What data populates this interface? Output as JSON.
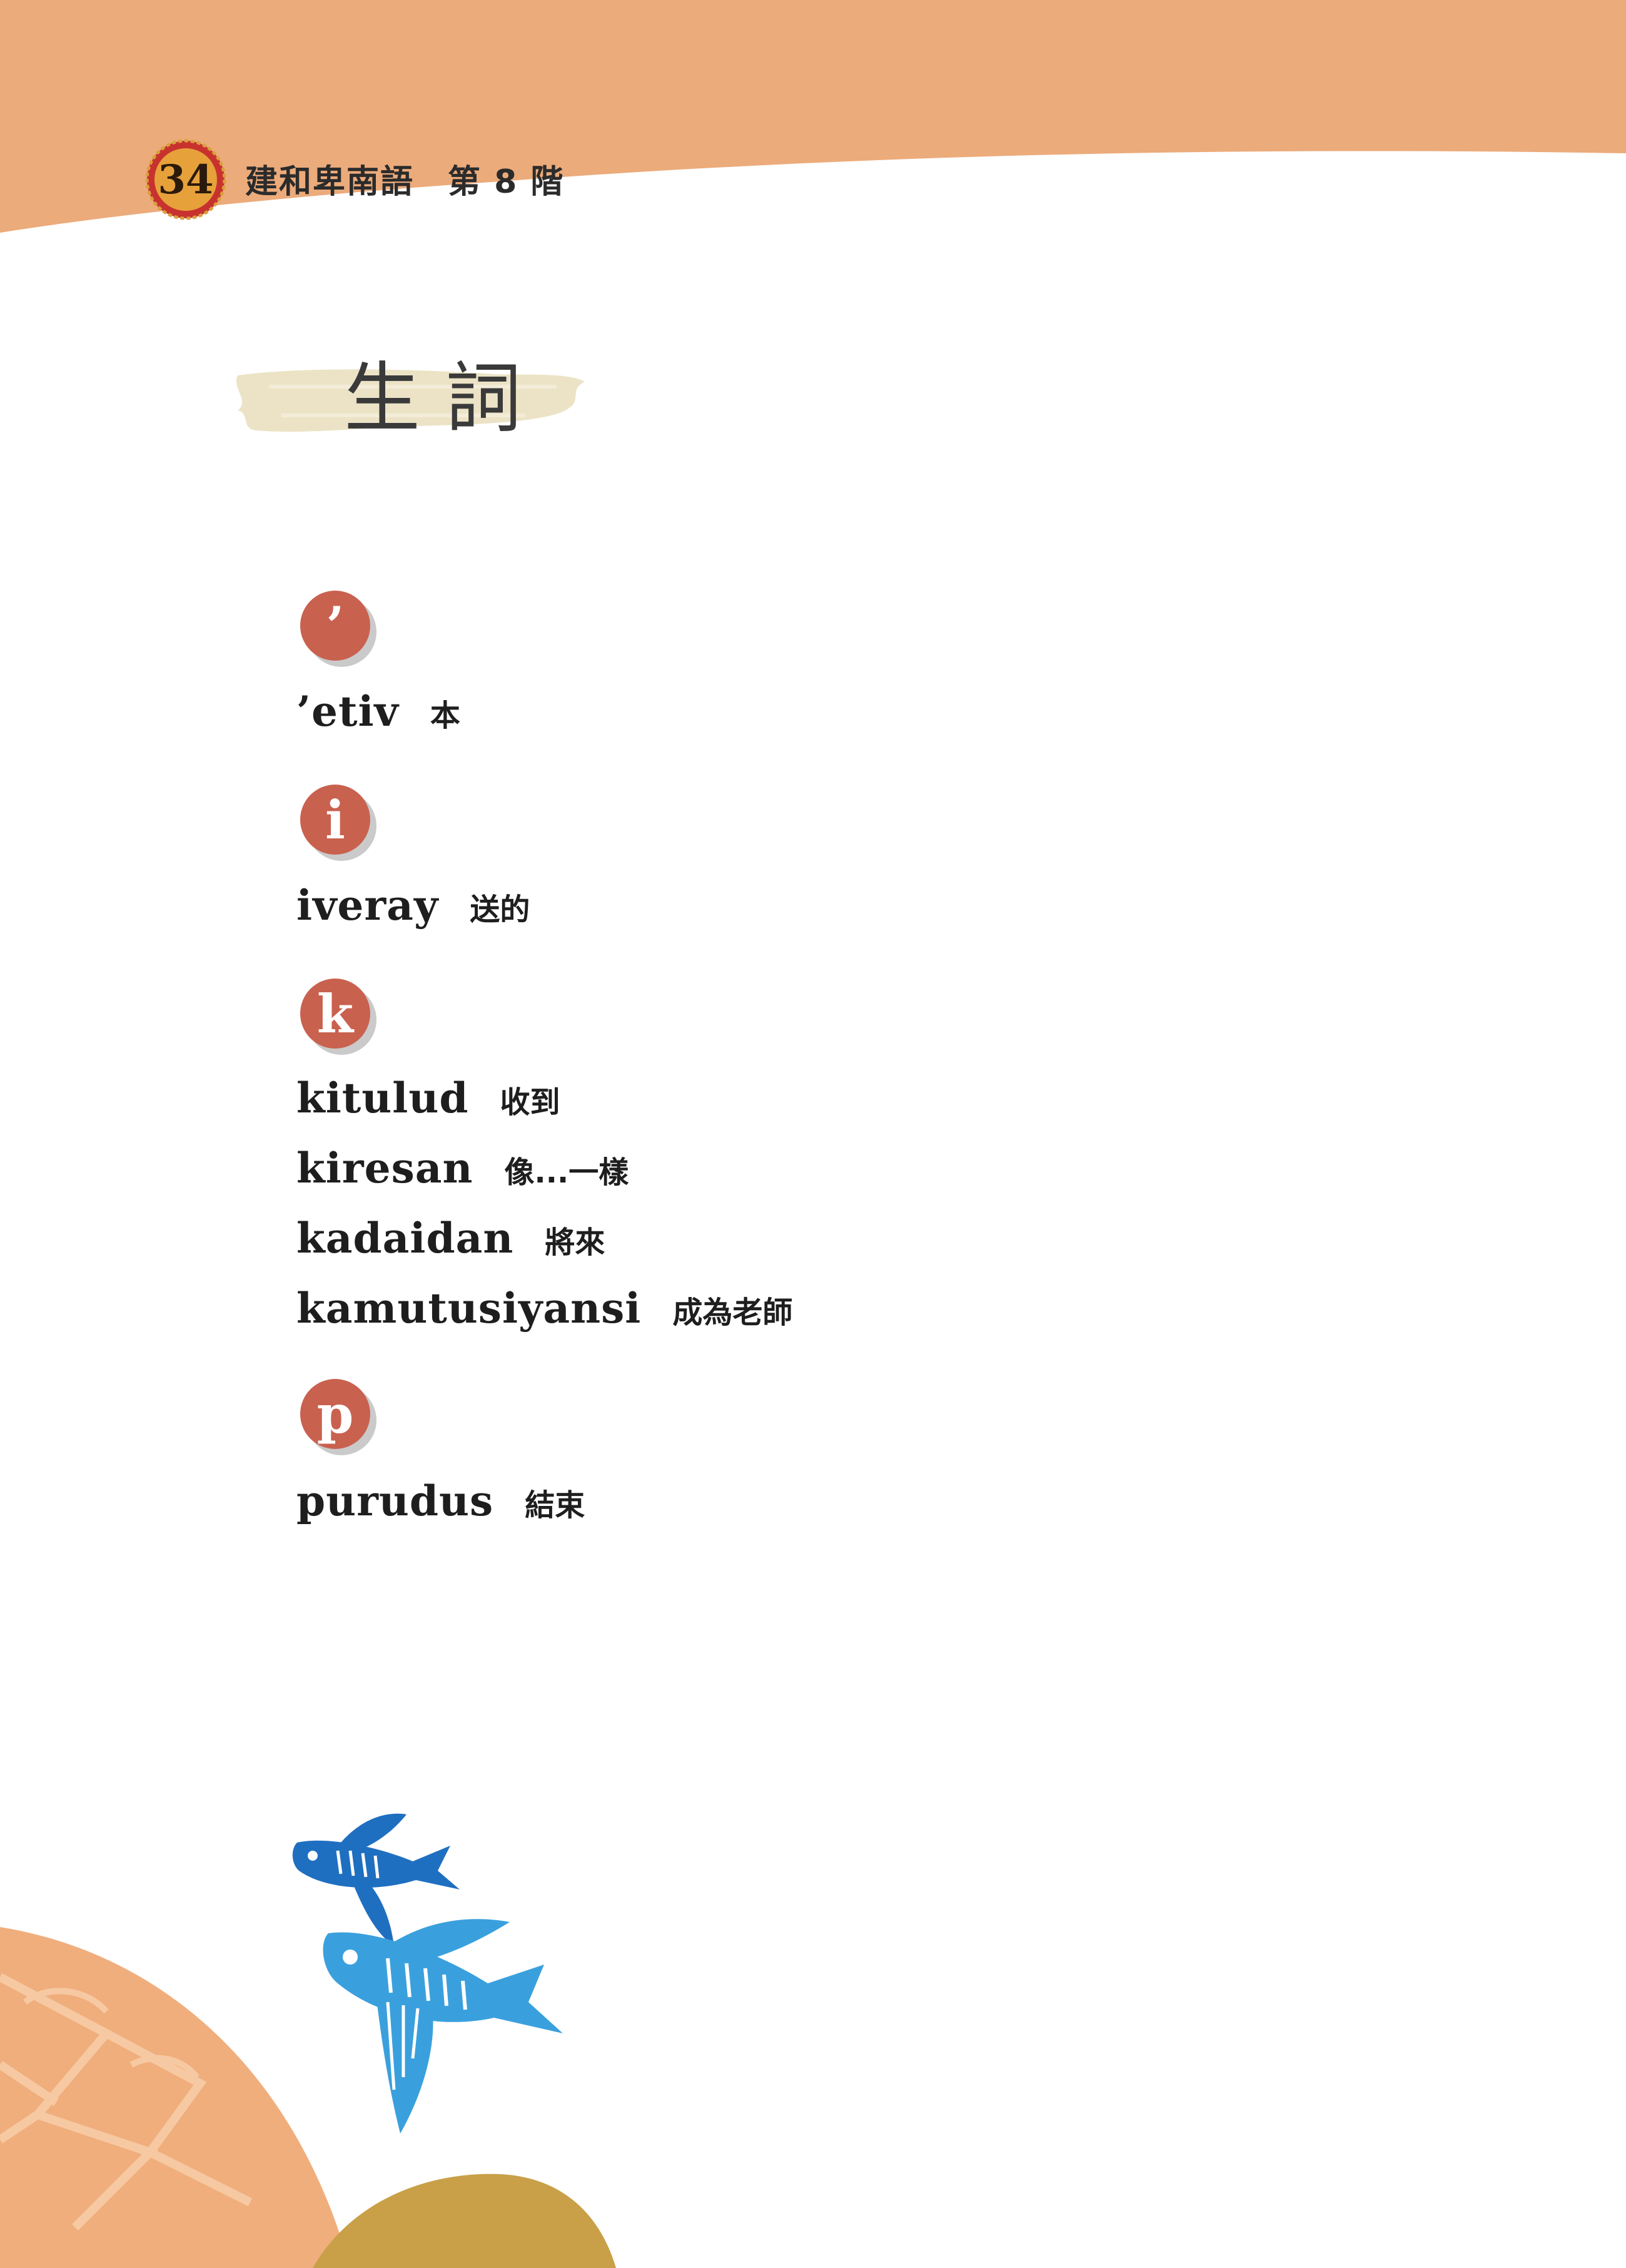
{
  "header": {
    "page_number": "34",
    "book_title": "建和卑南語　第 8 階",
    "band_color": "#ecab7b",
    "badge_color": "#c8322e"
  },
  "section": {
    "title": "生詞"
  },
  "glossary": [
    {
      "letter": "’",
      "entries": [
        {
          "word": "’etiv",
          "meaning": "本"
        }
      ]
    },
    {
      "letter": "i",
      "entries": [
        {
          "word": "iveray",
          "meaning": "送的"
        }
      ]
    },
    {
      "letter": "k",
      "entries": [
        {
          "word": "kitulud",
          "meaning": "收到"
        },
        {
          "word": "kiresan",
          "meaning": "像...一樣"
        },
        {
          "word": "kadaidan",
          "meaning": "將來"
        },
        {
          "word": "kamutusiyansi",
          "meaning": "成為老師"
        }
      ]
    },
    {
      "letter": "p",
      "entries": [
        {
          "word": "purudus",
          "meaning": "結束"
        }
      ]
    }
  ],
  "colors": {
    "letter_badge": "#c9614f",
    "fish_dark": "#1f6fc1",
    "fish_light": "#3aa0dd",
    "hill_gold": "#c9a048",
    "hill_peach": "#f0ae7d"
  },
  "decorations": {
    "icons": [
      "flying-fish-icon",
      "flying-fish-icon"
    ]
  }
}
